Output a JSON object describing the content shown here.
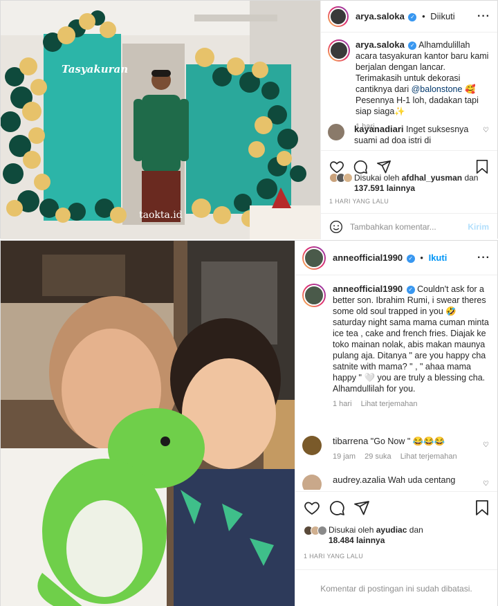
{
  "post1": {
    "username": "arya.saloka",
    "follow_state": "Diikuti",
    "caption_user": "arya.saloka",
    "caption_part1": "Alhamdulillah acara tasyakuran kantor baru kami berjalan dengan lancar. Terimakasih untuk dekorasi cantiknya dari ",
    "caption_mention": "@balonstone",
    "caption_part2": " 🥰 Pesennya H-1 loh, dadakan tapi siap siaga✨",
    "caption_time": "1 hari",
    "comment_user": "kayanadiari",
    "comment_text": "Inget suksesnya suami ad doa istri di dlmnya,,,hargai,",
    "liked_by_prefix": "Disukai oleh",
    "liked_by_user": "afdhal_yusman",
    "liked_and": "dan",
    "likes_count": "137.591 lainnya",
    "date": "1 HARI YANG LALU",
    "add_comment_placeholder": "Tambahkan komentar...",
    "send_label": "Kirim",
    "photo_sign": "Tasyakuran",
    "watermark": "taokta.id"
  },
  "post2": {
    "username": "anneofficial1990",
    "follow_state": "Ikuti",
    "caption_user": "anneofficial1990",
    "caption_text": "Couldn't ask for a better son. Ibrahim Rumi, i swear theres some old soul trapped in you 🤣 saturday night sama mama cuman minta ice tea , cake and french fries. Diajak ke toko mainan nolak, abis makan maunya pulang aja. Ditanya \" are you happy cha satnite with mama? \" , \" ahaa mama happy \" 🤍 you are truly a blessing cha. Alhamdullilah for you.",
    "caption_time": "1 hari",
    "see_translation": "Lihat terjemahan",
    "comment1_user": "tibarrena",
    "comment1_text": "\"Go Now \" 😂😂😂",
    "comment1_time": "19 jam",
    "comment1_likes": "29 suka",
    "comment1_translate": "Lihat terjemahan",
    "comment2_user": "audrey.azalia",
    "comment2_text": "Wah uda centang",
    "liked_by_prefix": "Disukai oleh",
    "liked_by_user": "ayudiac",
    "liked_and": "dan",
    "likes_count": "18.484 lainnya",
    "date": "1 HARI YANG LALU",
    "comments_limited": "Komentar di postingan ini sudah dibatasi."
  },
  "colors": {
    "link_blue": "#0095f6",
    "verified_blue": "#3897f0",
    "muted_gray": "#8e8e8e",
    "teal_backdrop": "#2cb5a8",
    "balloon_gold": "#e7c26a",
    "balloon_green": "#0f4a3c"
  },
  "icons": [
    "heart-icon",
    "comment-icon",
    "share-icon",
    "bookmark-icon",
    "emoji-icon",
    "more-icon",
    "verified-icon"
  ]
}
